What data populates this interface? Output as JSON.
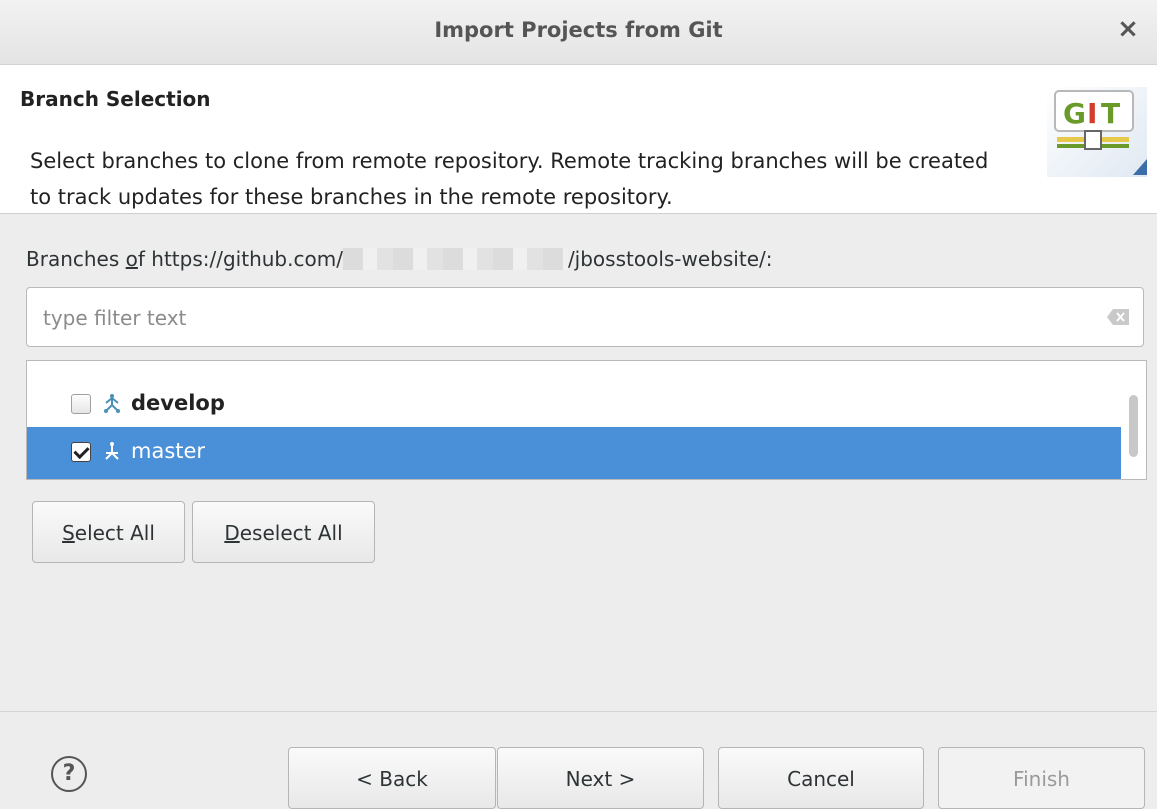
{
  "window": {
    "title": "Import Projects from Git",
    "close_glyph": "×"
  },
  "header": {
    "heading": "Branch Selection",
    "description": "Select branches to clone from remote repository. Remote tracking branches will be created to track updates for these branches in the remote repository.",
    "logo_text": "GIT"
  },
  "branches": {
    "label_prefix": "Branches ",
    "label_mnemonic": "o",
    "label_mid": "f https://github.com/",
    "label_suffix": "/jbosstools-website/:",
    "filter_placeholder": "type filter text",
    "filter_value": "",
    "items": [
      {
        "label": "develop",
        "checked": false,
        "selected": false
      },
      {
        "label": "master",
        "checked": true,
        "selected": true
      }
    ]
  },
  "actions": {
    "select_all_mnemonic": "S",
    "select_all_rest": "elect All",
    "deselect_all_mnemonic": "D",
    "deselect_all_rest": "eselect All"
  },
  "footer": {
    "help_glyph": "?",
    "back": "< Back",
    "next": "Next >",
    "cancel": "Cancel",
    "finish": "Finish"
  },
  "colors": {
    "selection": "#4a90d9",
    "git_green": "#6a9a2a",
    "git_red": "#d33c2b"
  }
}
